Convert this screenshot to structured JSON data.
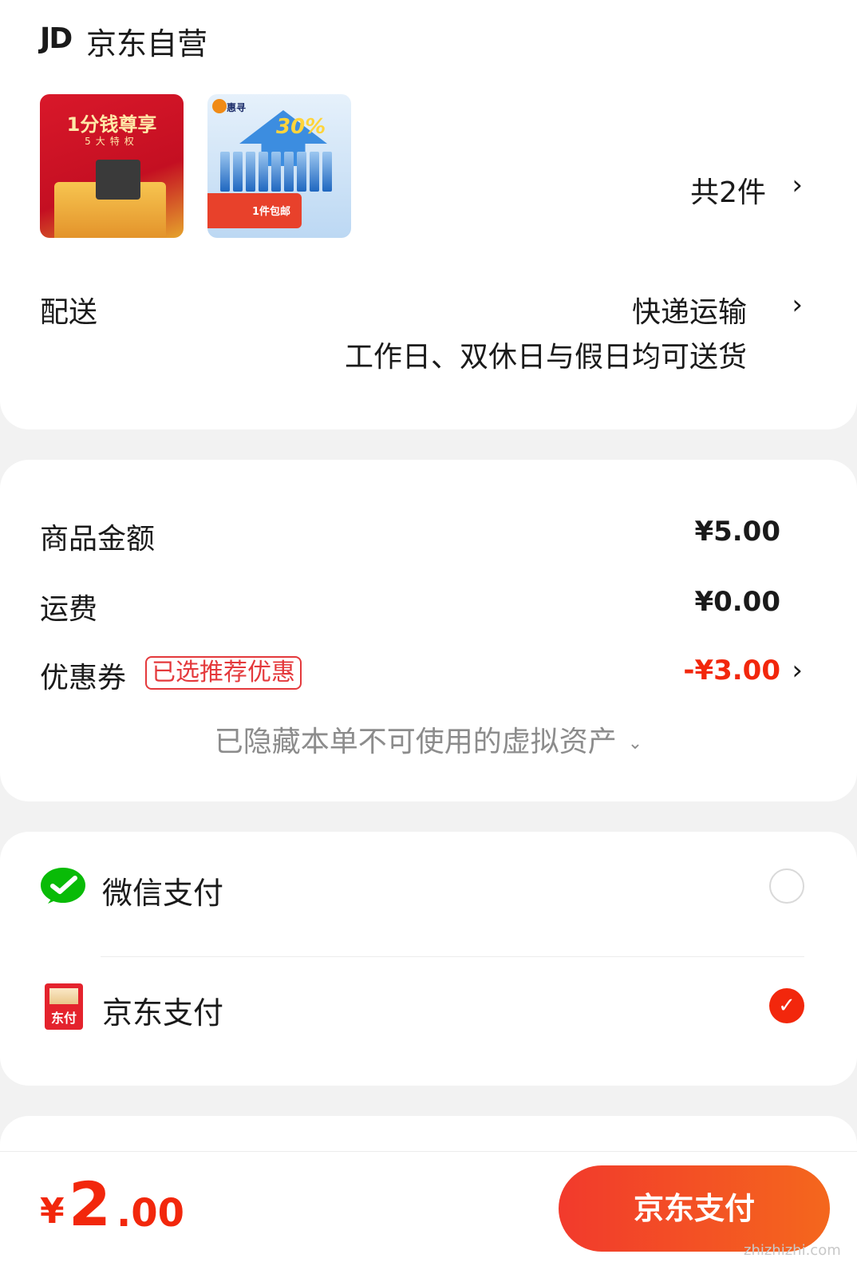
{
  "store": {
    "logo": "JD",
    "name": "京东自营"
  },
  "items": {
    "thumb1": {
      "title": "1分钱尊享",
      "subtitle": "5大特权"
    },
    "thumb2": {
      "brand": "惠寻",
      "percent": "30%",
      "tag": "1件包邮"
    },
    "count_label": "共2件"
  },
  "shipping": {
    "label": "配送",
    "method": "快递运输",
    "note": "工作日、双休日与假日均可送货"
  },
  "fees": {
    "goods_label": "商品金额",
    "goods_value": "¥5.00",
    "freight_label": "运费",
    "freight_value": "¥0.00",
    "coupon_label": "优惠券",
    "coupon_badge": "已选推荐优惠",
    "coupon_value": "-¥3.00",
    "hidden_note": "已隐藏本单不可使用的虚拟资产"
  },
  "payment": {
    "wechat_label": "微信支付",
    "jd_label": "京东支付",
    "jd_icon_text": "东付",
    "selected": "京东支付"
  },
  "footer": {
    "total_symbol": "¥",
    "total_int": "2",
    "total_dec": ".00",
    "pay_button": "京东支付",
    "watermark": "zhizhizhi.com"
  },
  "colors": {
    "accent": "#f2270c",
    "wechat": "#09bb07"
  }
}
